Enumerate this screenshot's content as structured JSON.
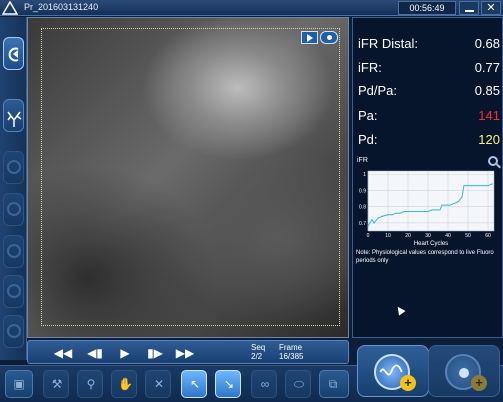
{
  "header": {
    "title": "Pr_201603131240",
    "time": "00:56:49",
    "close_label": "✕"
  },
  "playback": {
    "controls": [
      "◀◀",
      "◀▮",
      "▶",
      "▮▶",
      "▶▶"
    ],
    "seq_label": "Seq",
    "frame_label": "Frame",
    "seq_value": "2/2",
    "frame_value": "16/385"
  },
  "metrics": [
    {
      "label": "iFR Distal:",
      "value": "0.68",
      "color": "#ffffff"
    },
    {
      "label": "iFR:",
      "value": "0.77",
      "color": "#ffffff"
    },
    {
      "label": "Pd/Pa:",
      "value": "0.85",
      "color": "#ffffff"
    },
    {
      "label": "Pa:",
      "value": "141",
      "color": "#ff2b2b"
    },
    {
      "label": "Pd:",
      "value": "120",
      "color": "#fff27a"
    }
  ],
  "chart_data": {
    "type": "line",
    "title": "iFR",
    "xlabel": "Heart Cycles",
    "ylabel": "",
    "xlim": [
      0,
      63
    ],
    "ylim": [
      0.65,
      1.02
    ],
    "x_ticks": [
      "0",
      "10",
      "20",
      "30",
      "40",
      "50",
      "60"
    ],
    "y_ticks": [
      "0.7",
      "0.8",
      "0.9",
      "1"
    ],
    "grid": true,
    "series": [
      {
        "name": "",
        "color": "#39b8d8",
        "x": [
          0,
          2,
          3,
          5,
          7,
          10,
          12,
          14,
          16,
          18,
          20,
          22,
          24,
          26,
          28,
          30,
          32,
          34,
          36,
          37,
          39,
          41,
          43,
          45,
          47,
          48,
          50,
          52,
          54,
          56,
          58,
          60,
          62
        ],
        "y": [
          0.68,
          0.72,
          0.7,
          0.73,
          0.74,
          0.75,
          0.75,
          0.76,
          0.76,
          0.77,
          0.77,
          0.77,
          0.77,
          0.77,
          0.77,
          0.77,
          0.78,
          0.78,
          0.78,
          0.81,
          0.81,
          0.81,
          0.82,
          0.83,
          0.86,
          0.93,
          0.93,
          0.93,
          0.93,
          0.93,
          0.93,
          0.93,
          0.94
        ]
      }
    ]
  },
  "note": "Note: Physiological values correspond to live Fluoro periods only",
  "sidebar_icons": [
    "back-arrow-icon",
    "angio-tree-icon",
    "zoom-icon",
    "pen-icon",
    "measure-icon",
    "roi-icon",
    "settings-icon",
    "info-icon"
  ],
  "toolbar_icons": [
    "monitor-icon",
    "gavel-icon",
    "figure-icon",
    "hand-icon",
    "cross-icon",
    "arrow-select-icon",
    "arrow-down-right-icon",
    "link-icon",
    "capsule-icon",
    "screens-icon"
  ],
  "bigbuttons": [
    "add-measurement",
    "add-recording"
  ]
}
